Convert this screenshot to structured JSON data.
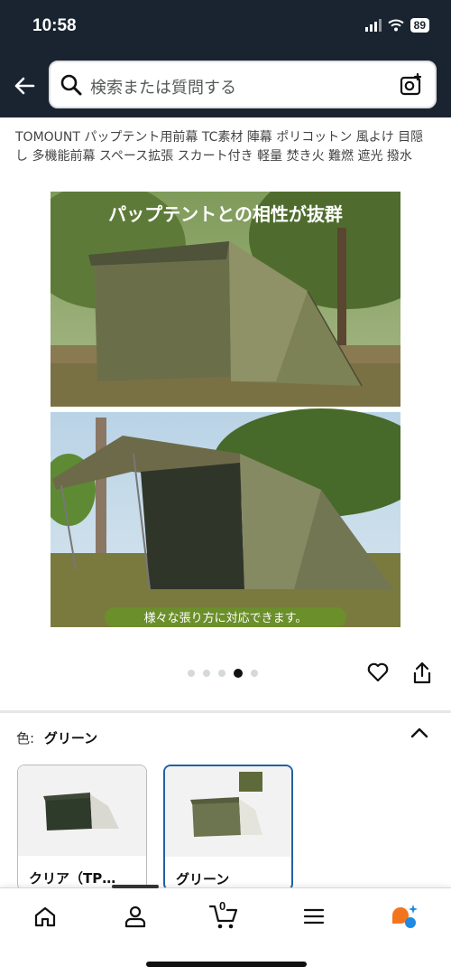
{
  "status_bar": {
    "time": "10:58",
    "battery": "89"
  },
  "search": {
    "placeholder": "検索または質問する"
  },
  "product": {
    "title": "TOMOUNT パップテント用前幕 TC素材 陣幕 ポリコットン 風よけ 目隠し 多機能前幕 スペース拡張 スカート付き 軽量 焚き火 難燃 遮光 撥水",
    "image": {
      "top_caption": "パップテントとの相性が抜群",
      "bottom_caption": "様々な張り方に対応できます。"
    },
    "carousel": {
      "count": 5,
      "active_index": 3
    }
  },
  "variation": {
    "label": "色:",
    "selected": "グリーン",
    "options": [
      {
        "label": "クリア（TP…",
        "selected": false
      },
      {
        "label": "グリーン",
        "selected": true
      }
    ]
  },
  "tab_bar": {
    "cart_count": "0"
  },
  "colors": {
    "header_bg": "#1a2431",
    "selected_border": "#2162a1",
    "accent_orange": "#f2751e",
    "accent_blue": "#1f8ae0"
  }
}
